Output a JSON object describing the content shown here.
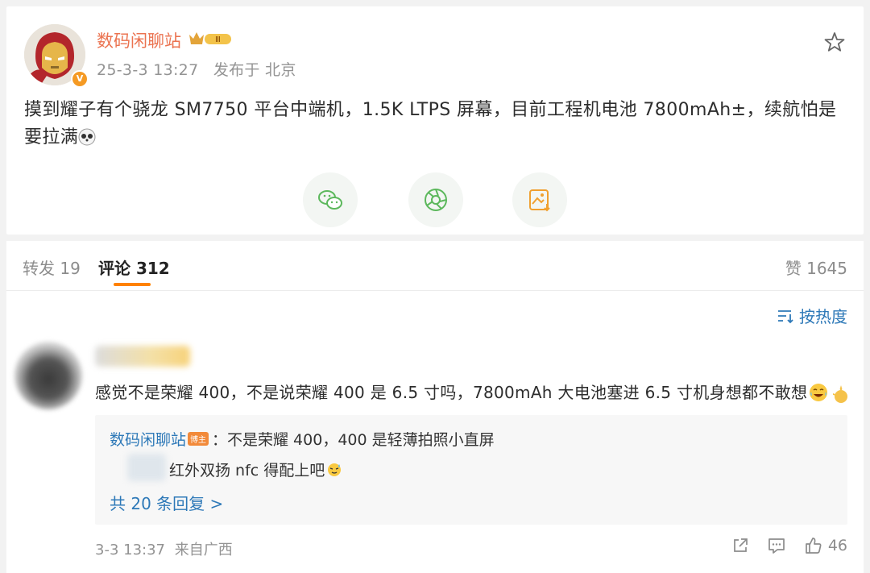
{
  "post": {
    "username": "数码闲聊站",
    "vip_badge_text": "Ⅲ",
    "timestamp": "25-3-3 13:27",
    "location": "发布于 北京",
    "text": "摸到耀子有个骁龙 SM7750 平台中端机，1.5K LTPS 屏幕，目前工程机电池 7800mAh±，续航怕是要拉满",
    "share_buttons": [
      "wechat-icon",
      "moments-icon",
      "save-image-icon"
    ]
  },
  "tabs": {
    "repost": "转发 19",
    "comments": "评论 312",
    "likes": "赞 1645"
  },
  "sort": {
    "label": "按热度"
  },
  "comment": {
    "text": "感觉不是荣耀 400，不是说荣耀 400 是 6.5 寸吗，7800mAh 大电池塞进 6.5 寸机身想都不敢想",
    "replies": {
      "reply1_name": "数码闲聊站",
      "reply1_badge": "博主",
      "reply1_text": "：不是荣耀 400，400 是轻薄拍照小直屏",
      "reply2_text": "红外双扬 nfc 得配上吧",
      "more_label": "共 20 条回复 >"
    },
    "time": "3-3 13:37",
    "source": "来自广西",
    "likes": "46"
  },
  "colors": {
    "username": "#eb7350",
    "link": "#2e79b8",
    "tab_accent": "#ff8200",
    "share_icon": "#5cb85c",
    "save_icon": "#f0a030"
  }
}
